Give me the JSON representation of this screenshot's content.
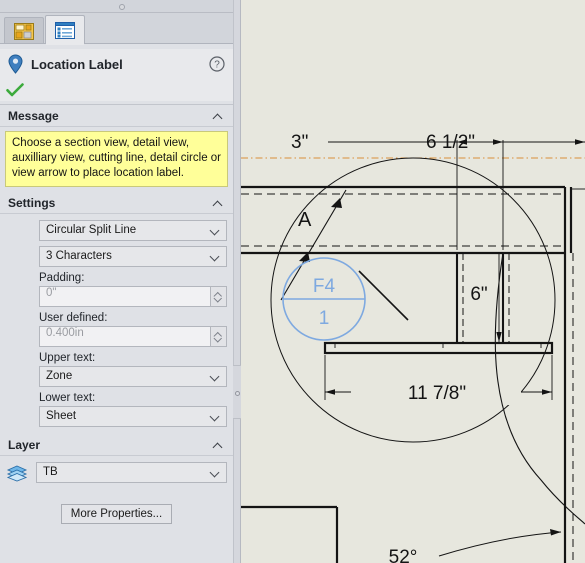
{
  "panel": {
    "tabs": [
      {
        "name": "property-manager-tab",
        "icon": "property-manager-icon",
        "active": false
      },
      {
        "name": "feature-manager-tab",
        "icon": "feature-manager-tree-icon",
        "active": true
      }
    ],
    "title": "Location Label",
    "icons": {
      "title_icon": "map-pin-icon",
      "help": "help-question-icon",
      "confirm": "green-check-icon",
      "layer": "layers-stack-icon"
    },
    "message": {
      "header": "Message",
      "text": "Choose a section view, detail view, auxilliary view, cutting line, detail circle or view arrow to place location label."
    },
    "settings": {
      "header": "Settings",
      "style_value": "Circular Split Line",
      "style_options": [
        "Circular Split Line"
      ],
      "characters_value": "3 Characters",
      "characters_options": [
        "3 Characters"
      ],
      "padding_label": "Padding:",
      "padding_value": "0\"",
      "user_defined_label": "User defined:",
      "user_defined_value": "0.400in",
      "upper_text_label": "Upper text:",
      "upper_text_value": "Zone",
      "upper_text_options": [
        "Zone"
      ],
      "lower_text_label": "Lower text:",
      "lower_text_value": "Sheet",
      "lower_text_options": [
        "Sheet"
      ]
    },
    "layer": {
      "header": "Layer",
      "value": "TB",
      "options": [
        "TB"
      ]
    },
    "more_properties_label": "More Properties..."
  },
  "drawing": {
    "dimensions": {
      "dim_3in": "3\"",
      "dim_6_5in": "6 1/2\"",
      "dim_6in": "6\"",
      "dim_11_875in": "11 7/8\"",
      "dim_angle": "52°"
    },
    "view_arrow_label": "A",
    "location_label": {
      "upper": "F4",
      "lower": "1",
      "color": "#7ea9e0"
    }
  },
  "colors": {
    "panel_bg": "#dfe1e6",
    "canvas_bg": "#e7e7de",
    "message_bg": "#ffff99",
    "accent_blue": "#2f7fc1",
    "confirm_green": "#3caa3c",
    "centerline_orange": "#d98f3a",
    "label_blue": "#7ea9e0"
  }
}
